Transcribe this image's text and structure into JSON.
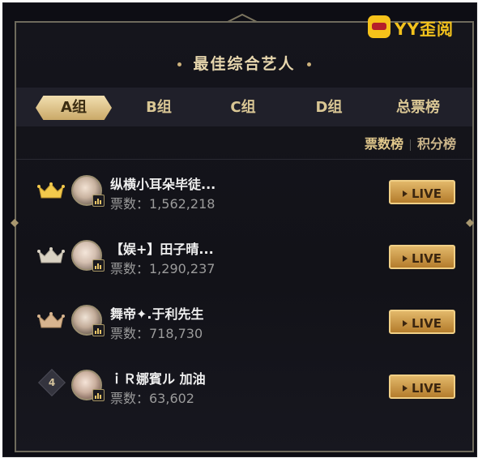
{
  "brand": {
    "text": "YY歪阅"
  },
  "title": "最佳综合艺人",
  "tabs": [
    {
      "label": "A组",
      "active": true
    },
    {
      "label": "B组",
      "active": false
    },
    {
      "label": "C组",
      "active": false
    },
    {
      "label": "D组",
      "active": false
    },
    {
      "label": "总票榜",
      "active": false
    }
  ],
  "sort": {
    "votes_label": "票数榜",
    "points_label": "积分榜"
  },
  "ranking": [
    {
      "rank": "1",
      "medal": "gold",
      "name": "纵横小耳朵毕徒...",
      "votes": "票数：1,562,218",
      "live_label": "LIVE"
    },
    {
      "rank": "2",
      "medal": "silver",
      "name": "【娱+】田子晴...",
      "votes": "票数：1,290,237",
      "live_label": "LIVE"
    },
    {
      "rank": "3",
      "medal": "bronze",
      "name": "舞帝✦.于利先生",
      "votes": "票数：718,730",
      "live_label": "LIVE"
    },
    {
      "rank": "4",
      "medal": "none",
      "name": "ｉＲ娜賓ル 加油",
      "votes": "票数：63,602",
      "live_label": "LIVE"
    }
  ],
  "colors": {
    "gold": "#f2c94c",
    "silver": "#d9d2c3",
    "bronze": "#d7b48f",
    "accent": "#e1c88c"
  }
}
